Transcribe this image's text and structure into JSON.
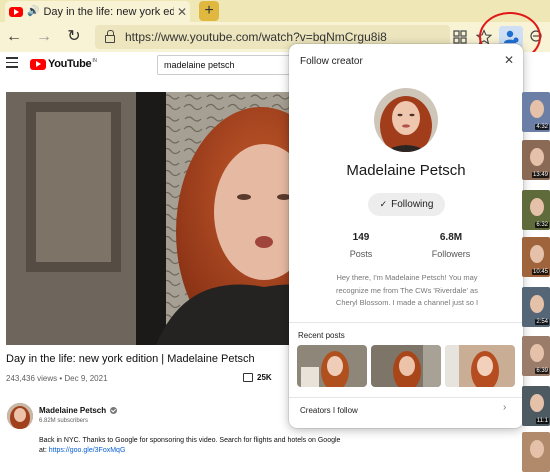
{
  "browser": {
    "tab_title": "Day in the life: new york edi",
    "tab_close": "✕",
    "new_tab": "+",
    "back": "←",
    "forward": "→",
    "refresh": "↻",
    "url": "https://www.youtube.com/watch?v=bqNmCrgu8i8"
  },
  "youtube": {
    "logo_text": "YouTube",
    "logo_region": "IN",
    "search_value": "madelaine petsch",
    "video_title": "Day in the life: new york edition | Madelaine Petsch",
    "video_stats": "243,436 views • Dec 9, 2021",
    "likes": "25K",
    "channel_name": "Madelaine Petsch",
    "subscribers": "6.82M subscribers",
    "description_line1": "Back in NYC. Thanks to Google for sponsoring this video. Search for flights and hotels on Google",
    "description_line2_prefix": "at: ",
    "description_link": "https://goo.gle/3FoxMqG",
    "sidebar_times": [
      "4:32",
      "13:49",
      "6:32",
      "10:45",
      "2:54",
      "6:39",
      "11:1"
    ]
  },
  "follow_panel": {
    "header": "Follow creator",
    "close": "✕",
    "creator_name": "Madelaine Petsch",
    "following_label": "Following",
    "posts_count": "149",
    "posts_label": "Posts",
    "followers_count": "6.8M",
    "followers_label": "Followers",
    "bio": "Hey there, I'm Madelaine Petsch! You may recognize me from The CWs 'Riverdale' as Cheryl Blossom. I made a channel just so I",
    "recent_posts_label": "Recent posts",
    "creators_follow_label": "Creators I follow",
    "chevron": "›"
  },
  "colors": {
    "tab_strip": "#efe7b6",
    "address_bar": "#f9f3d6",
    "highlight_circle": "#e01818",
    "youtube_red": "#ff0000",
    "link_blue": "#065fd4"
  }
}
